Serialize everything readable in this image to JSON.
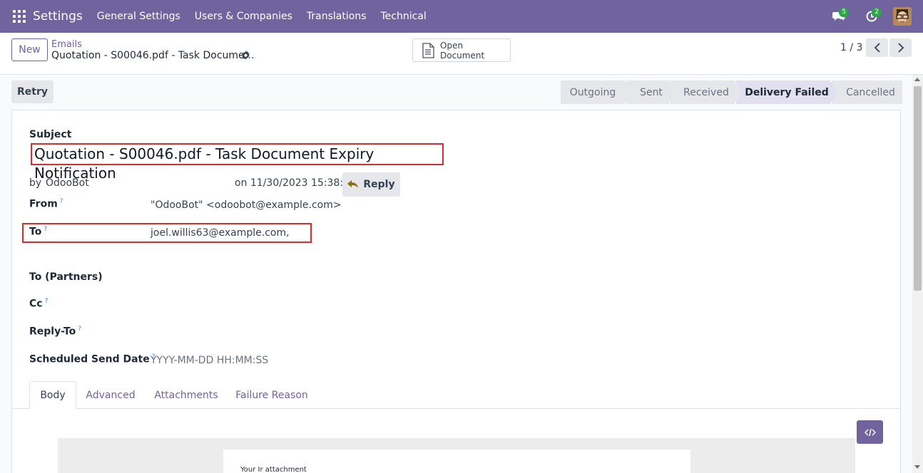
{
  "navbar": {
    "app_name": "Settings",
    "menu": [
      "General Settings",
      "Users & Companies",
      "Translations",
      "Technical"
    ],
    "messages_count": "5",
    "activities_count": "2"
  },
  "control_panel": {
    "new_label": "New",
    "breadcrumb_parent": "Emails",
    "breadcrumb_current": "Quotation - S00046.pdf - Task Docume…",
    "open_document_label": "Open Document",
    "pager": "1 / 3"
  },
  "statusbar": {
    "retry_label": "Retry",
    "stages": [
      "Outgoing",
      "Sent",
      "Received",
      "Delivery Failed",
      "Cancelled"
    ],
    "active_stage": "Delivery Failed"
  },
  "form": {
    "subject_label": "Subject",
    "subject_value": "Quotation - S00046.pdf - Task Document Expiry Notification",
    "by_prefix": "by",
    "author": "OdooBot",
    "date_text": "on 11/30/2023 15:38:52",
    "reply_label": "Reply",
    "from_label": "From",
    "from_value": "\"OdooBot\" <odoobot@example.com>",
    "to_label": "To",
    "to_value": "joel.willis63@example.com,",
    "to_partners_label": "To (Partners)",
    "cc_label": "Cc",
    "reply_to_label": "Reply-To",
    "scheduled_label": "Scheduled Send Date",
    "scheduled_placeholder": "YYYY-MM-DD HH:MM:SS",
    "help_mark": "?"
  },
  "tabs": [
    "Body",
    "Advanced",
    "Attachments",
    "Failure Reason"
  ],
  "body_preview": {
    "text": "Your Ir attachment"
  },
  "colors": {
    "brand": "#71639e",
    "highlight_box": "#d32f2f",
    "badge": "#28a745"
  }
}
